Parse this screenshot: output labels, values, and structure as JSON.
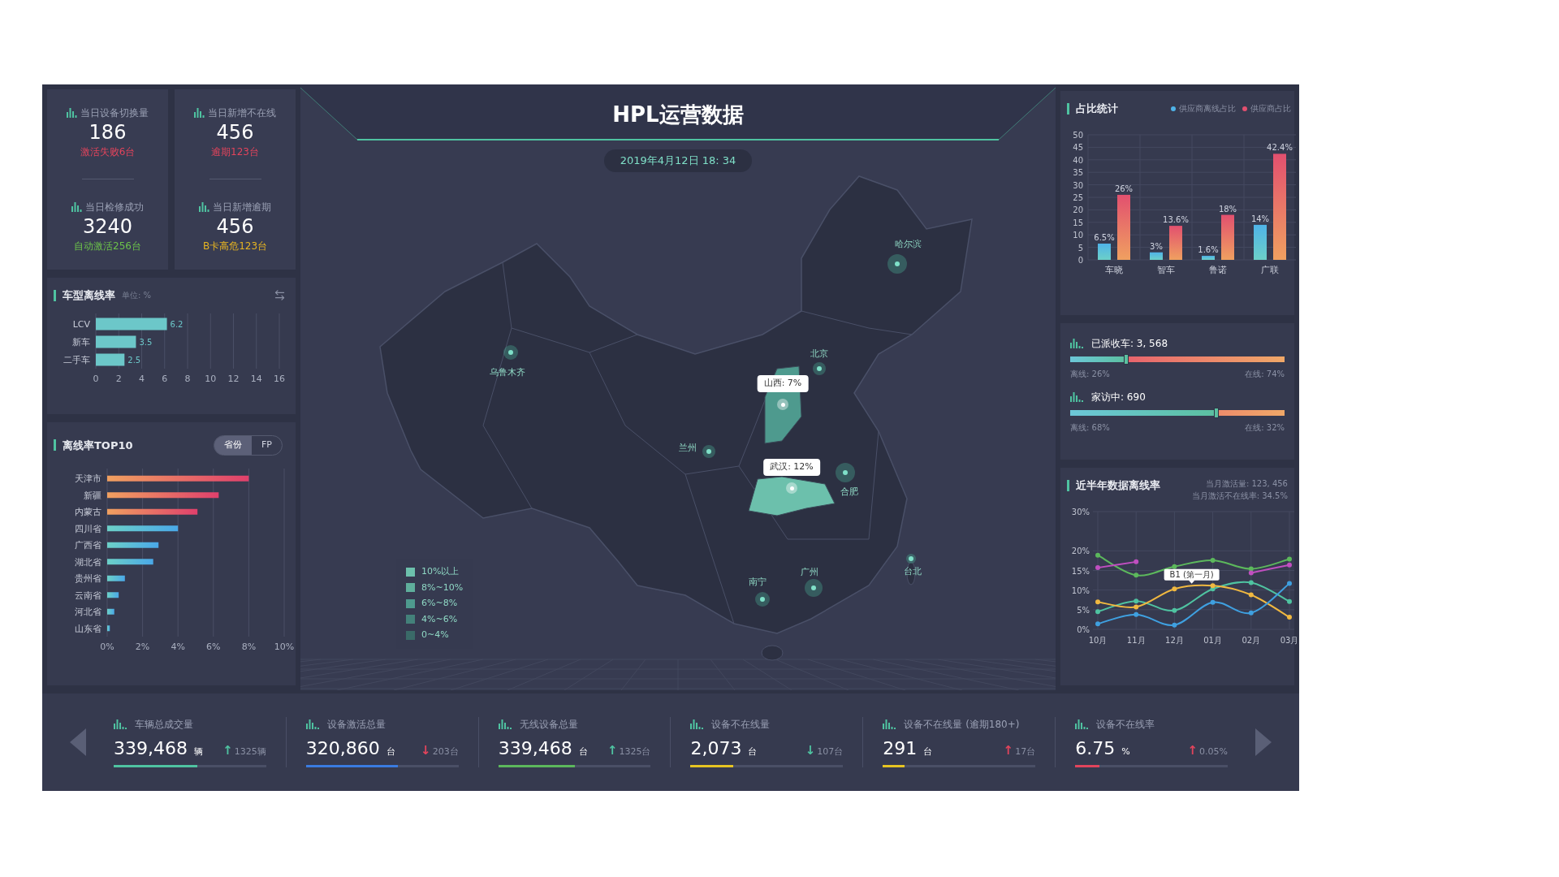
{
  "header": {
    "title": "HPL运营数据",
    "datetime": "2019年4月12日 18: 34"
  },
  "kpi_cards": [
    {
      "items": [
        {
          "label": "当日设备切换量",
          "value": "186",
          "note": "激活失败6台",
          "color": "#e2445c"
        },
        {
          "label": "当日检修成功",
          "value": "3240",
          "note": "自动激活256台",
          "color": "#6cc24a"
        }
      ]
    },
    {
      "items": [
        {
          "label": "当日新增不在线",
          "value": "456",
          "note": "逾期123台",
          "color": "#e2445c"
        },
        {
          "label": "当日新增逾期",
          "value": "456",
          "note": "B卡高危123台",
          "color": "#e6b422"
        }
      ]
    }
  ],
  "vehicle_offline": {
    "title": "车型离线率",
    "unit": "单位: %",
    "chart_data": {
      "type": "bar",
      "orientation": "horizontal",
      "categories": [
        "LCV",
        "新车",
        "二手车"
      ],
      "series": [
        {
          "color": "#6cc7c9",
          "values": [
            6.2,
            3.5,
            2.5
          ]
        }
      ],
      "xlim": [
        0,
        16
      ],
      "xticks": [
        0,
        2,
        4,
        6,
        8,
        10,
        12,
        14,
        16
      ],
      "grid": true,
      "data_labels": true
    }
  },
  "top10": {
    "title": "离线率TOP10",
    "toggle": [
      {
        "label": "省份",
        "selected": true
      },
      {
        "label": "FP",
        "selected": false
      }
    ],
    "chart_data": {
      "type": "bar",
      "orientation": "horizontal",
      "categories": [
        "天津市",
        "新疆",
        "内蒙古",
        "四川省",
        "广西省",
        "湖北省",
        "贵州省",
        "云南省",
        "河北省",
        "山东省"
      ],
      "series": [
        {
          "values": [
            8,
            6.3,
            5.1,
            4,
            2.9,
            2.6,
            1,
            0.65,
            0.4,
            0.15
          ]
        }
      ],
      "xlim": [
        0,
        10
      ],
      "xticks": [
        {
          "value": 0,
          "label": "0%"
        },
        {
          "value": 2,
          "label": "2%"
        },
        {
          "value": 4,
          "label": "4%"
        },
        {
          "value": 6,
          "label": "6%"
        },
        {
          "value": 8,
          "label": "8%"
        },
        {
          "value": 10,
          "label": "10%"
        }
      ],
      "grid": true
    }
  },
  "share_stats": {
    "title": "占比统计",
    "chart_data": {
      "type": "bar",
      "categories": [
        "车晓",
        "智车",
        "鲁诺",
        "广联"
      ],
      "series": [
        {
          "name": "供应商离线占比",
          "color": "#4fb3e8",
          "values": [
            6.5,
            3,
            1.6,
            14
          ]
        },
        {
          "name": "供应商占比",
          "color": "#e2506f",
          "values": [
            26,
            13.6,
            18,
            42.4
          ]
        }
      ],
      "ylim": [
        0,
        50
      ],
      "yticks": [
        0,
        5,
        10,
        15,
        20,
        25,
        30,
        35,
        40,
        45,
        50
      ],
      "grid": true,
      "value_labels": [
        [
          "6.5%",
          "3%",
          "1.6%",
          "14%"
        ],
        [
          "26%",
          "13.6%",
          "18%",
          "42.4%"
        ]
      ]
    }
  },
  "split_bars": [
    {
      "label": "已派收车: 3, 568",
      "level": 0.26,
      "left": "离线: 26%",
      "right": "在线: 74%"
    },
    {
      "label": "家访中: 690",
      "level": 0.68,
      "left": "离线: 68%",
      "right": "在线: 32%"
    }
  ],
  "offline_trend": {
    "title": "近半年数据离线率",
    "stats": [
      "当月激活量: 123, 456",
      "当月激活不在线率: 34.5%"
    ],
    "chart_data": {
      "type": "line",
      "x": [
        "10月",
        "11月",
        "12月",
        "01月",
        "02月",
        "03月"
      ],
      "ylim": [
        0,
        30
      ],
      "yticks": [
        {
          "value": 0,
          "label": "0%"
        },
        {
          "value": 5,
          "label": "5%"
        },
        {
          "value": 10,
          "label": "10%"
        },
        {
          "value": 15,
          "label": "15%"
        },
        {
          "value": 20,
          "label": "20%"
        },
        {
          "value": 30,
          "label": "30%"
        }
      ],
      "grid": true,
      "series": [
        {
          "color": "#5cb85c",
          "marker": "circle",
          "values": [
            18.9,
            13.8,
            16,
            17.6,
            15.4,
            17.9
          ]
        },
        {
          "color": "#c04fc0",
          "marker": "circle",
          "values": [
            15.7,
            17.2,
            null,
            null,
            14.4,
            16.4
          ]
        },
        {
          "color": "#4fc3a1",
          "marker": "circle",
          "values": [
            4.5,
            7.2,
            4.8,
            10.3,
            11.9,
            7.1
          ]
        },
        {
          "color": "#f0b840",
          "marker": "circle",
          "values": [
            7,
            5.7,
            10.3,
            11.1,
            8.8,
            3.1
          ]
        },
        {
          "color": "#3fa0e0",
          "marker": "circle",
          "values": [
            1.4,
            3.8,
            1.1,
            6.9,
            4.2,
            11.7
          ]
        }
      ],
      "annotations": [
        {
          "text": "B1 (第一月)",
          "x": "12月",
          "y": 11.2
        }
      ]
    }
  },
  "map": {
    "cities": [
      {
        "name": "哈尔滨"
      },
      {
        "name": "乌鲁木齐"
      },
      {
        "name": "北京"
      },
      {
        "name": "兰州"
      },
      {
        "name": "合肥"
      },
      {
        "name": "南宁"
      },
      {
        "name": "广州"
      },
      {
        "name": "台北"
      }
    ],
    "tooltips": [
      {
        "text": "山西: 7%"
      },
      {
        "text": "武汉: 12%"
      }
    ],
    "legend": [
      {
        "label": "10%以上",
        "color": "#6cc0ac"
      },
      {
        "label": "8%~10%",
        "color": "#5fae9c"
      },
      {
        "label": "6%~8%",
        "color": "#4e9a8e"
      },
      {
        "label": "4%~6%",
        "color": "#43817a"
      },
      {
        "label": "0~4%",
        "color": "#3a6a68"
      }
    ]
  },
  "bottom_stats": [
    {
      "label": "车辆总成交量",
      "value": "339,468",
      "unit": "辆",
      "delta": {
        "arrow": "↑",
        "text": "1325辆",
        "color": "#4fc3a1"
      },
      "level": 0.55,
      "color": "#4fc3a1"
    },
    {
      "label": "设备激活总量",
      "value": "320,860",
      "unit": "台",
      "delta": {
        "arrow": "↓",
        "text": "203台",
        "color": "#e2445c"
      },
      "level": 0.6,
      "color": "#3a7be0"
    },
    {
      "label": "无线设备总量",
      "value": "339,468",
      "unit": "台",
      "delta": {
        "arrow": "↑",
        "text": "1325台",
        "color": "#4fc3a1"
      },
      "level": 0.5,
      "color": "#5cb85c"
    },
    {
      "label": "设备不在线量",
      "value": "2,073",
      "unit": "台",
      "delta": {
        "arrow": "↓",
        "text": "107台",
        "color": "#4fc3a1"
      },
      "level": 0.28,
      "color": "#e6c422"
    },
    {
      "label": "设备不在线量 (逾期180+)",
      "value": "291",
      "unit": "台",
      "delta": {
        "arrow": "↑",
        "text": "17台",
        "color": "#e2445c"
      },
      "level": 0.14,
      "color": "#e6c422"
    },
    {
      "label": "设备不在线率",
      "value": "6.75",
      "unit": "%",
      "delta": {
        "arrow": "↑",
        "text": "0.05%",
        "color": "#e2445c"
      },
      "level": 0.16,
      "color": "#e2445c"
    }
  ]
}
